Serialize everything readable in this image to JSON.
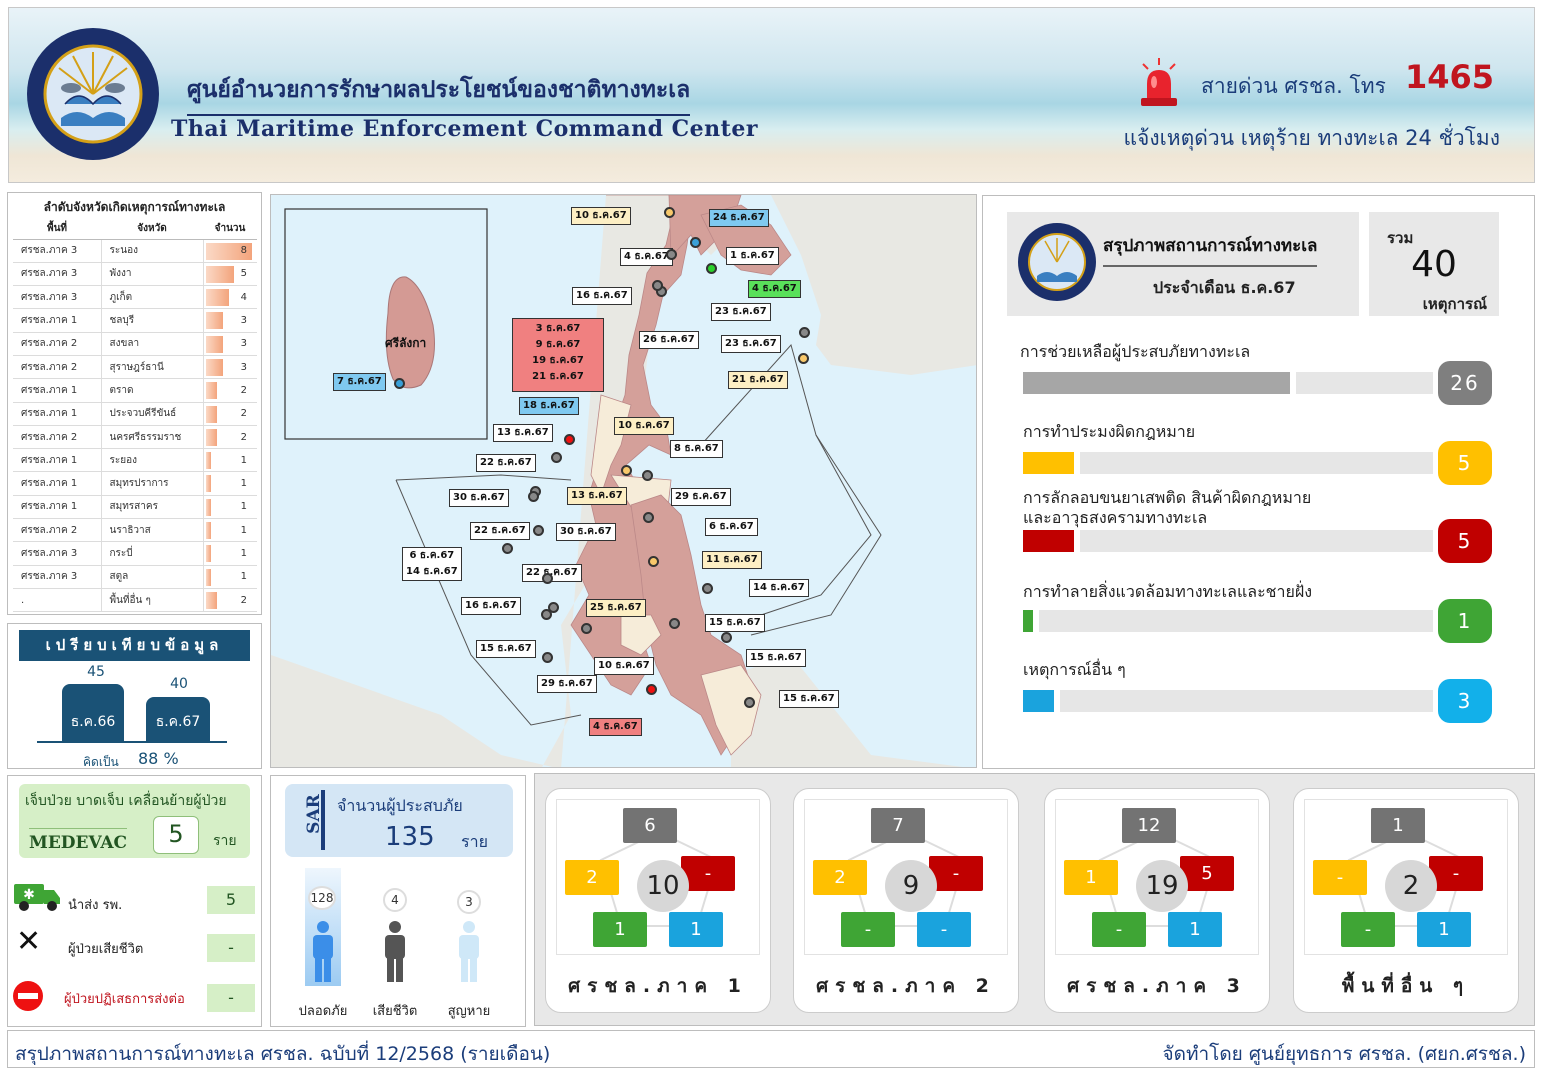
{
  "header": {
    "title_th": "ศูนย์อำนวยการรักษาผลประโยชน์ของชาติทางทะเล",
    "title_en": "Thai Maritime Enforcement Command Center",
    "logo_text": "THAI MARITIME ENFORCEMENT COMMAND CENTER",
    "hotline_label": "สายด่วน ศรชล. โทร",
    "hotline_number": "1465",
    "hotline_sub": "แจ้งเหตุด่วน เหตุร้าย ทางทะเล 24 ชั่วโมง"
  },
  "province_ranking": {
    "title": "ลำดับจังหวัดเกิดเหตุการณ์ทางทะเล",
    "headers": [
      "พื้นที่",
      "จังหวัด",
      "จำนวน"
    ],
    "rows": [
      {
        "area": "ศรชล.ภาค 3",
        "province": "ระนอง",
        "count": 8
      },
      {
        "area": "ศรชล.ภาค 3",
        "province": "พังงา",
        "count": 5
      },
      {
        "area": "ศรชล.ภาค 3",
        "province": "ภูเก็ต",
        "count": 4
      },
      {
        "area": "ศรชล.ภาค 1",
        "province": "ชลบุรี",
        "count": 3
      },
      {
        "area": "ศรชล.ภาค 2",
        "province": "สงขลา",
        "count": 3
      },
      {
        "area": "ศรชล.ภาค 2",
        "province": "สุราษฎร์ธานี",
        "count": 3
      },
      {
        "area": "ศรชล.ภาค 1",
        "province": "ตราด",
        "count": 2
      },
      {
        "area": "ศรชล.ภาค 1",
        "province": "ประจวบคีรีขันธ์",
        "count": 2
      },
      {
        "area": "ศรชล.ภาค 2",
        "province": "นครศรีธรรมราช",
        "count": 2
      },
      {
        "area": "ศรชล.ภาค 1",
        "province": "ระยอง",
        "count": 1
      },
      {
        "area": "ศรชล.ภาค 1",
        "province": "สมุทรปราการ",
        "count": 1
      },
      {
        "area": "ศรชล.ภาค 1",
        "province": "สมุทรสาคร",
        "count": 1
      },
      {
        "area": "ศรชล.ภาค 2",
        "province": "นราธิวาส",
        "count": 1
      },
      {
        "area": "ศรชล.ภาค 3",
        "province": "กระบี่",
        "count": 1
      },
      {
        "area": "ศรชล.ภาค 3",
        "province": "สตูล",
        "count": 1
      },
      {
        "area": ".",
        "province": "พื้นที่อื่น ๆ",
        "count": 2
      }
    ]
  },
  "compare": {
    "title": "เปรียบเทียบข้อมูล",
    "bars": [
      {
        "label": "ธ.ค.66",
        "value": 45
      },
      {
        "label": "ธ.ค.67",
        "value": 40
      }
    ],
    "percent_label": "คิดเป็น",
    "percent": "88 %"
  },
  "map": {
    "sri_lanka_label": "ศรีลังกา",
    "tags": [
      {
        "text": "10 ธ.ค.67",
        "color": "y"
      },
      {
        "text": "24 ธ.ค.67",
        "color": "b"
      },
      {
        "text": "4 ธ.ค.67",
        "color": "w"
      },
      {
        "text": "1 ธ.ค.67",
        "color": "w"
      },
      {
        "text": "4 ธ.ค.67",
        "color": "g"
      },
      {
        "text": "16 ธ.ค.67",
        "color": "w"
      },
      {
        "text": "23 ธ.ค.67",
        "color": "w"
      },
      {
        "text": "26 ธ.ค.67",
        "color": "w"
      },
      {
        "text": "23 ธ.ค.67",
        "color": "w"
      },
      {
        "text": "21 ธ.ค.67",
        "color": "y"
      },
      {
        "text": "3 ธ.ค.67\n9 ธ.ค.67\n19 ธ.ค.67\n21 ธ.ค.67",
        "color": "r"
      },
      {
        "text": "18 ธ.ค.67",
        "color": "b"
      },
      {
        "text": "7 ธ.ค.67",
        "color": "b"
      },
      {
        "text": "10 ธ.ค.67",
        "color": "y"
      },
      {
        "text": "13 ธ.ค.67",
        "color": "w"
      },
      {
        "text": "8 ธ.ค.67",
        "color": "w"
      },
      {
        "text": "22 ธ.ค.67",
        "color": "w"
      },
      {
        "text": "30 ธ.ค.67",
        "color": "w"
      },
      {
        "text": "13 ธ.ค.67",
        "color": "y"
      },
      {
        "text": "29 ธ.ค.67",
        "color": "w"
      },
      {
        "text": "22 ธ.ค.67",
        "color": "w"
      },
      {
        "text": "30 ธ.ค.67",
        "color": "w"
      },
      {
        "text": "6 ธ.ค.67",
        "color": "w"
      },
      {
        "text": "6 ธ.ค.67\n14 ธ.ค.67",
        "color": "w"
      },
      {
        "text": "11 ธ.ค.67",
        "color": "y"
      },
      {
        "text": "22 ธ.ค.67",
        "color": "w"
      },
      {
        "text": "14 ธ.ค.67",
        "color": "w"
      },
      {
        "text": "16 ธ.ค.67",
        "color": "w"
      },
      {
        "text": "25 ธ.ค.67",
        "color": "y"
      },
      {
        "text": "15 ธ.ค.67",
        "color": "w"
      },
      {
        "text": "15 ธ.ค.67",
        "color": "w"
      },
      {
        "text": "15 ธ.ค.67",
        "color": "w"
      },
      {
        "text": "10 ธ.ค.67",
        "color": "w"
      },
      {
        "text": "29 ธ.ค.67",
        "color": "w"
      },
      {
        "text": "15 ธ.ค.67",
        "color": "w"
      },
      {
        "text": "4 ธ.ค.67",
        "color": "r"
      }
    ]
  },
  "summary": {
    "title": "สรุปภาพสถานการณ์ทางทะเล",
    "month": "ประจำเดือน ธ.ค.67",
    "total_label": "รวม",
    "total": "40",
    "total_unit": "เหตุการณ์",
    "categories": [
      {
        "label": "การช่วยเหลือผู้ประสบภัยทางทะเล",
        "value": "26",
        "fraction": 0.65,
        "color": "#a6a6a6",
        "badge_color": "#7f7f7f"
      },
      {
        "label": "การทำประมงผิดกฎหมาย",
        "value": "5",
        "fraction": 0.125,
        "color": "#ffc000",
        "badge_color": "#ffc000"
      },
      {
        "label": "การลักลอบขนยาเสพติด สินค้าผิดกฎหมาย\nและอาวุธสงครามทางทะเล",
        "value": "5",
        "fraction": 0.125,
        "color": "#c00000",
        "badge_color": "#c00000"
      },
      {
        "label": "การทำลายสิ่งแวดล้อมทางทะเลและชายฝั่ง",
        "value": "1",
        "fraction": 0.025,
        "color": "#3fa535",
        "badge_color": "#3fa535"
      },
      {
        "label": "เหตุการณ์อื่น ๆ",
        "value": "3",
        "fraction": 0.075,
        "color": "#1aa3dd",
        "badge_color": "#12b0ea"
      }
    ]
  },
  "medevac": {
    "title": "เจ็บป่วย บาดเจ็บ เคลื่อนย้ายผู้ป่วย",
    "label": "MEDEVAC",
    "count": "5",
    "unit": "ราย",
    "rows": [
      {
        "label": "นำส่ง รพ.",
        "value": "5"
      },
      {
        "label": "ผู้ป่วยเสียชีวิต",
        "value": "-"
      },
      {
        "label": "ผู้ป่วยปฏิเสธการส่งต่อ",
        "value": "-"
      }
    ]
  },
  "sar": {
    "code": "SAR",
    "title": "จำนวนผู้ประสบภัย",
    "count": "135",
    "unit": "ราย",
    "figures": [
      {
        "label": "ปลอดภัย",
        "value": "128"
      },
      {
        "label": "เสียชีวิต",
        "value": "4"
      },
      {
        "label": "สูญหาย",
        "value": "3"
      }
    ]
  },
  "regions": [
    {
      "name": "ศรชล.ภาค 1",
      "total": "10",
      "gray": "6",
      "yellow": "2",
      "red": "-",
      "green": "1",
      "blue": "1"
    },
    {
      "name": "ศรชล.ภาค 2",
      "total": "9",
      "gray": "7",
      "yellow": "2",
      "red": "-",
      "green": "-",
      "blue": "-"
    },
    {
      "name": "ศรชล.ภาค 3",
      "total": "19",
      "gray": "12",
      "yellow": "1",
      "red": "5",
      "green": "-",
      "blue": "1"
    },
    {
      "name": "พื้นที่อื่น ๆ",
      "total": "2",
      "gray": "1",
      "yellow": "-",
      "red": "-",
      "green": "-",
      "blue": "1"
    }
  ],
  "footer": {
    "left": "สรุปภาพสถานการณ์ทางทะเล ศรชล. ฉบับที่ 12/2568 (รายเดือน)",
    "right": "จัดทำโดย ศูนย์ยุทธการ ศรชล. (ศยก.ศรชล.)"
  }
}
